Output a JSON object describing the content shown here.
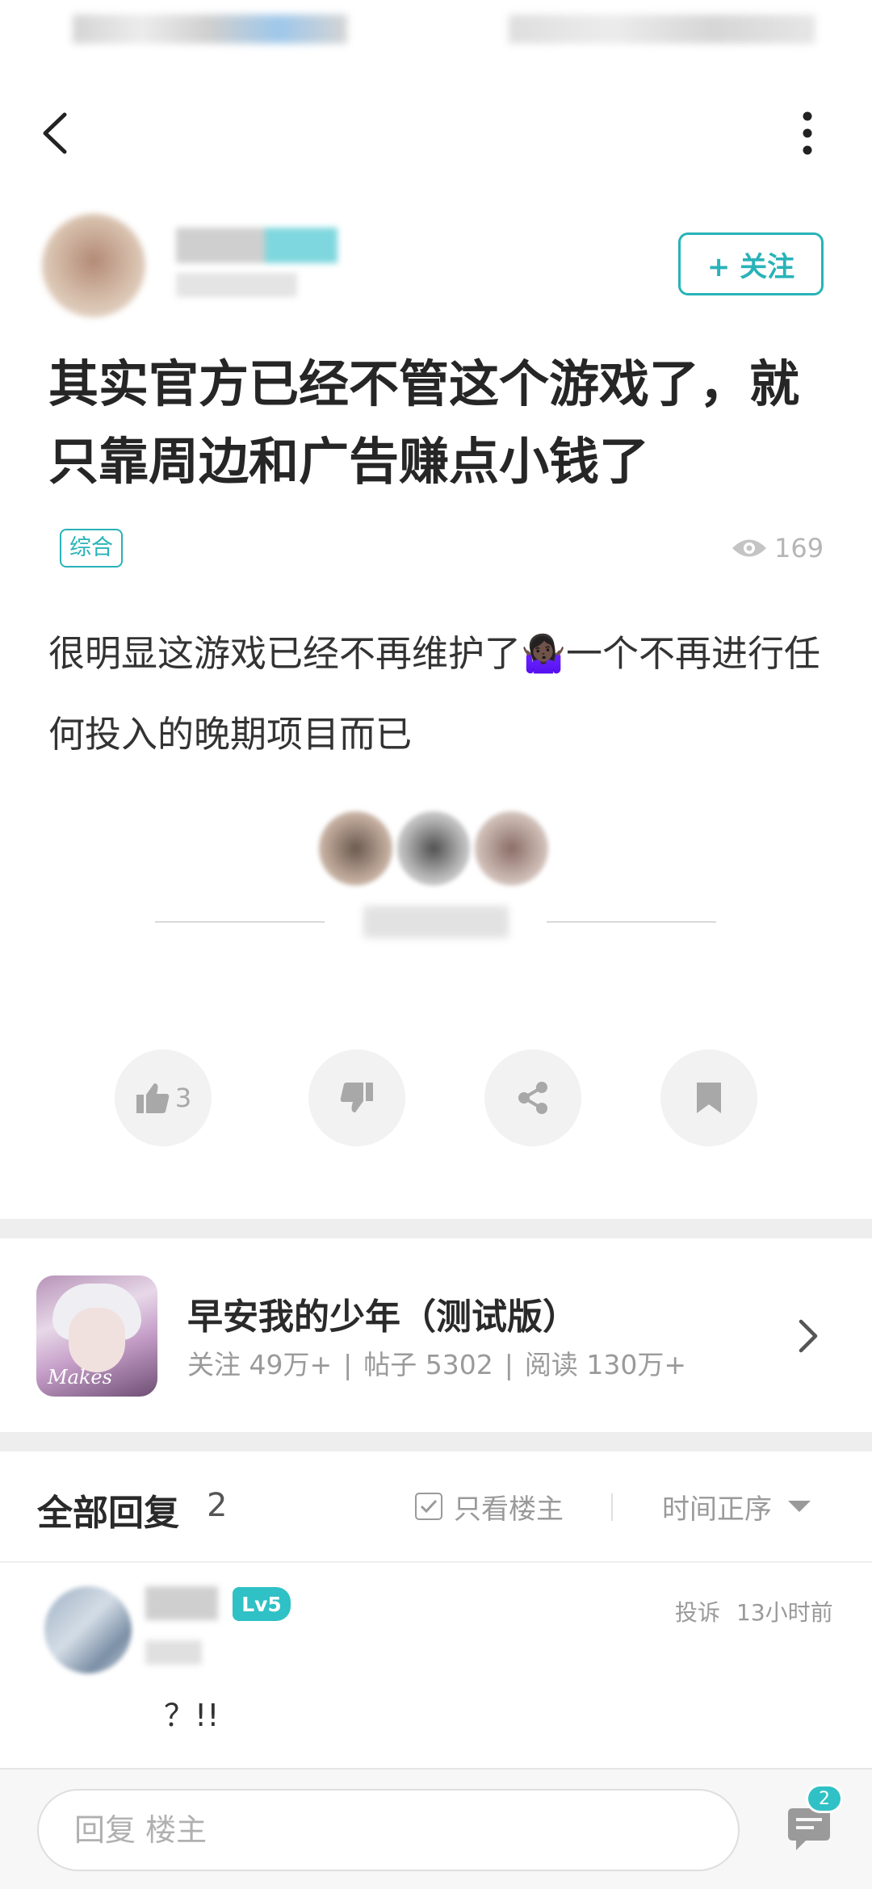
{
  "nav": {
    "back_icon": "chevron-left-icon",
    "more_icon": "more-vertical-icon"
  },
  "author": {
    "follow_label": "+ 关注"
  },
  "post": {
    "title": "其实官方已经不管这个游戏了，就只靠周边和广告赚点小钱了",
    "tag": "综合",
    "views": "169",
    "body": "很明显这游戏已经不再维护了🤷🏿‍♀️一个不再进行任何投入的晚期项目而已"
  },
  "actions": {
    "like_count": "3",
    "like_icon": "thumbs-up-icon",
    "dislike_icon": "thumbs-down-icon",
    "share_icon": "share-icon",
    "bookmark_icon": "bookmark-icon"
  },
  "game": {
    "name": "早安我的少年（测试版）",
    "follow_stat": "关注 49万+",
    "posts_stat": "帖子 5302",
    "reads_stat": "阅读 130万+",
    "separator": "|",
    "icon_logo_text": "Makes"
  },
  "replies": {
    "title": "全部回复",
    "count": "2",
    "only_owner_label": "只看楼主",
    "sort_label": "时间正序"
  },
  "reply_items": [
    {
      "level": "Lv5",
      "report_label": "投诉",
      "time": "13小时前",
      "text": "？!!"
    }
  ],
  "bottom": {
    "input_placeholder": "回复  楼主",
    "comment_badge": "2"
  },
  "colors": {
    "accent": "#29b3b8",
    "muted": "#9a9a9a"
  }
}
